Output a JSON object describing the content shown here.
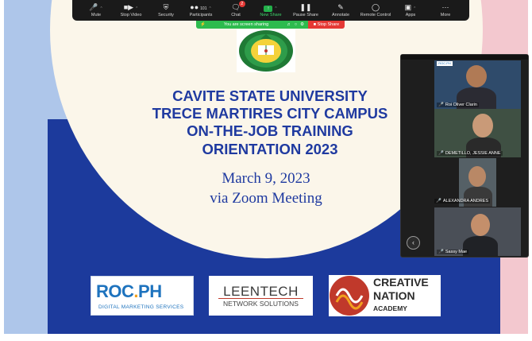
{
  "toolbar": {
    "items": [
      {
        "label": "Mute",
        "icon": "mic-icon"
      },
      {
        "label": "Stop Video",
        "icon": "video-camera-icon"
      },
      {
        "label": "Security",
        "icon": "shield-icon"
      },
      {
        "label": "Participants",
        "icon": "participants-icon",
        "count": "101"
      },
      {
        "label": "Chat",
        "icon": "chat-icon",
        "badge": "2"
      },
      {
        "label": "New Share",
        "icon": "share-screen-icon"
      },
      {
        "label": "Pause Share",
        "icon": "pause-icon"
      },
      {
        "label": "Annotate",
        "icon": "pencil-icon"
      },
      {
        "label": "Remote Control",
        "icon": "mouse-icon"
      },
      {
        "label": "Apps",
        "icon": "apps-icon"
      },
      {
        "label": "More",
        "icon": "more-dots-icon"
      }
    ]
  },
  "share_bar": {
    "status": "You are screen sharing",
    "stop_label": "Stop Share"
  },
  "slide": {
    "title_lines": [
      "CAVITE STATE UNIVERSITY",
      "TRECE MARTIRES CITY CAMPUS",
      "ON-THE-JOB TRAINING",
      "ORIENTATION 2023"
    ],
    "date": "March 9, 2023",
    "venue": "via Zoom Meeting",
    "sponsors": {
      "roc": {
        "main": "ROC",
        "dot": ".",
        "tld": "PH",
        "sub": "DIGITAL MARKETING SERVICES"
      },
      "leentech": {
        "main": "LEENTECH",
        "sub": "NETWORK SOLUTIONS"
      },
      "creative_nation": {
        "line1": "CREATIVE",
        "line2": "NATION",
        "line3": "ACADEMY"
      }
    },
    "colors": {
      "navy": "#1c3a9c",
      "title": "#1f3aa0",
      "cream": "#fbf6ea"
    }
  },
  "gallery": {
    "participants": [
      {
        "name": "Roi Oliver Clarin",
        "muted": true
      },
      {
        "name": "DEMETILLO, JESSIE ANNE",
        "muted": true
      },
      {
        "name": "ALEXANDRA ANDRES",
        "muted": true
      },
      {
        "name": "Sassy Mae",
        "muted": true
      }
    ],
    "tile_logo": "ROC.PH"
  }
}
